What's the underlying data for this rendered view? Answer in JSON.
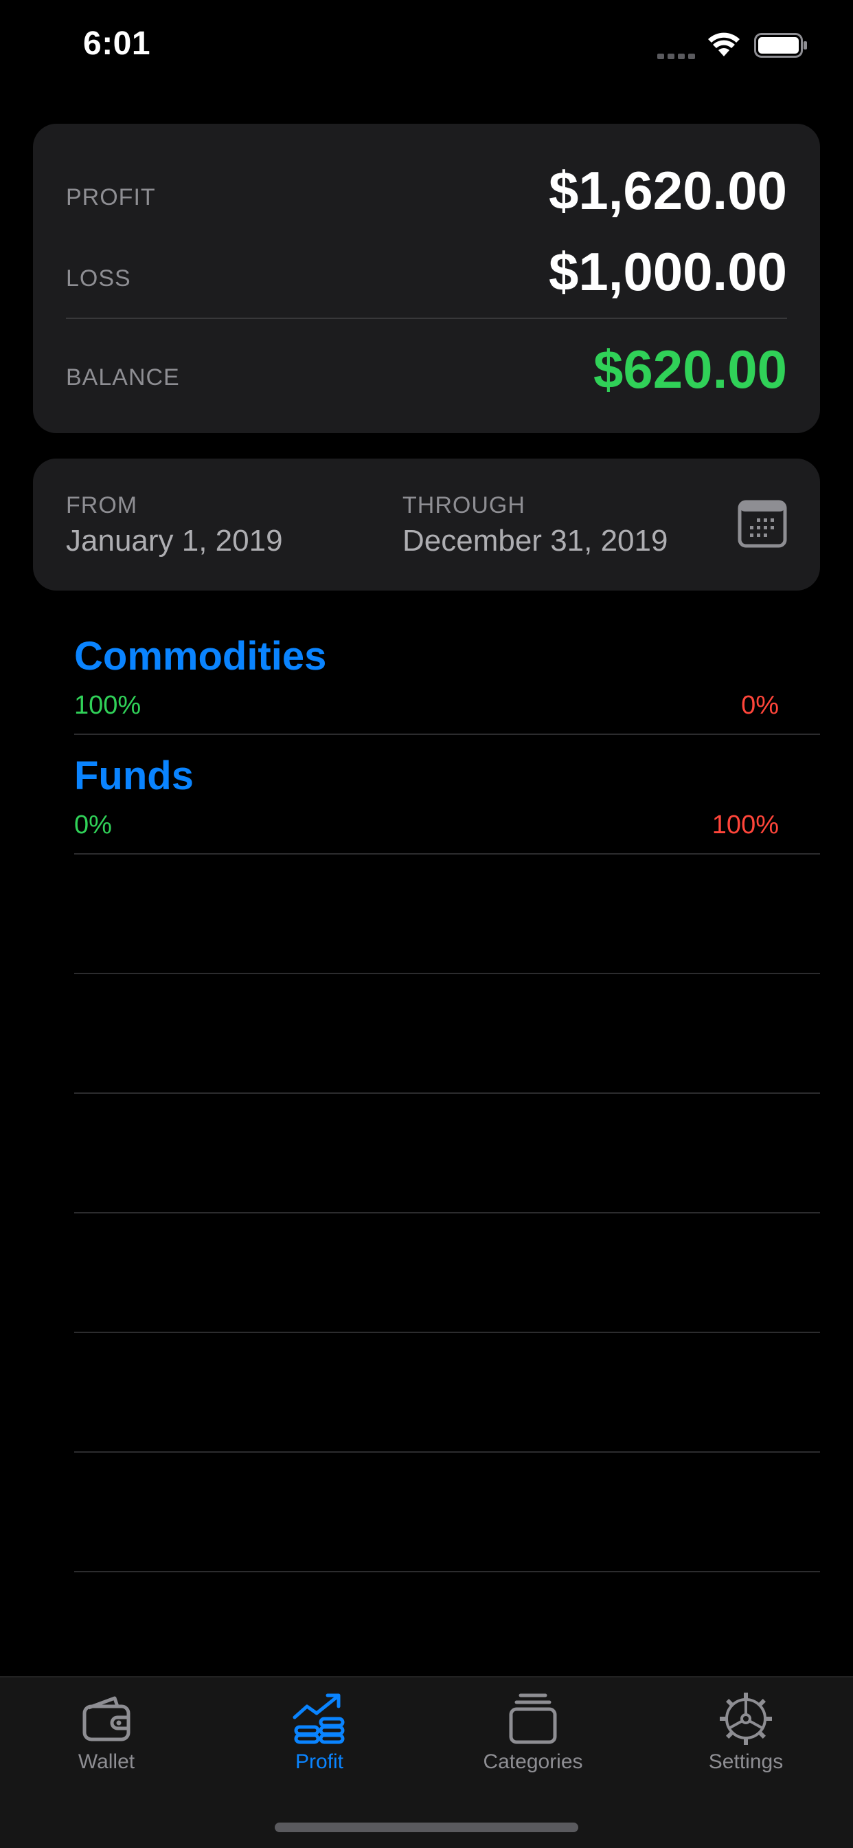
{
  "status_bar": {
    "time": "6:01"
  },
  "summary": {
    "profit_label": "PROFIT",
    "profit_value": "$1,620.00",
    "loss_label": "LOSS",
    "loss_value": "$1,000.00",
    "balance_label": "BALANCE",
    "balance_value": "$620.00"
  },
  "date_range": {
    "from_label": "FROM",
    "from_value": "January 1, 2019",
    "through_label": "THROUGH",
    "through_value": "December 31, 2019"
  },
  "categories": [
    {
      "name": "Commodities",
      "profit_percent": "100%",
      "loss_percent": "0%"
    },
    {
      "name": "Funds",
      "profit_percent": "0%",
      "loss_percent": "100%"
    }
  ],
  "tab_bar": {
    "items": [
      {
        "label": "Wallet",
        "icon": "wallet-icon",
        "active": false
      },
      {
        "label": "Profit",
        "icon": "profit-chart-icon",
        "active": true
      },
      {
        "label": "Categories",
        "icon": "categories-stack-icon",
        "active": false
      },
      {
        "label": "Settings",
        "icon": "gear-icon",
        "active": false
      }
    ]
  },
  "colors": {
    "accent": "#0a84ff",
    "positive": "#30d158",
    "negative": "#ff453a",
    "card": "#1c1c1e",
    "secondary_text": "#8e8e93"
  }
}
